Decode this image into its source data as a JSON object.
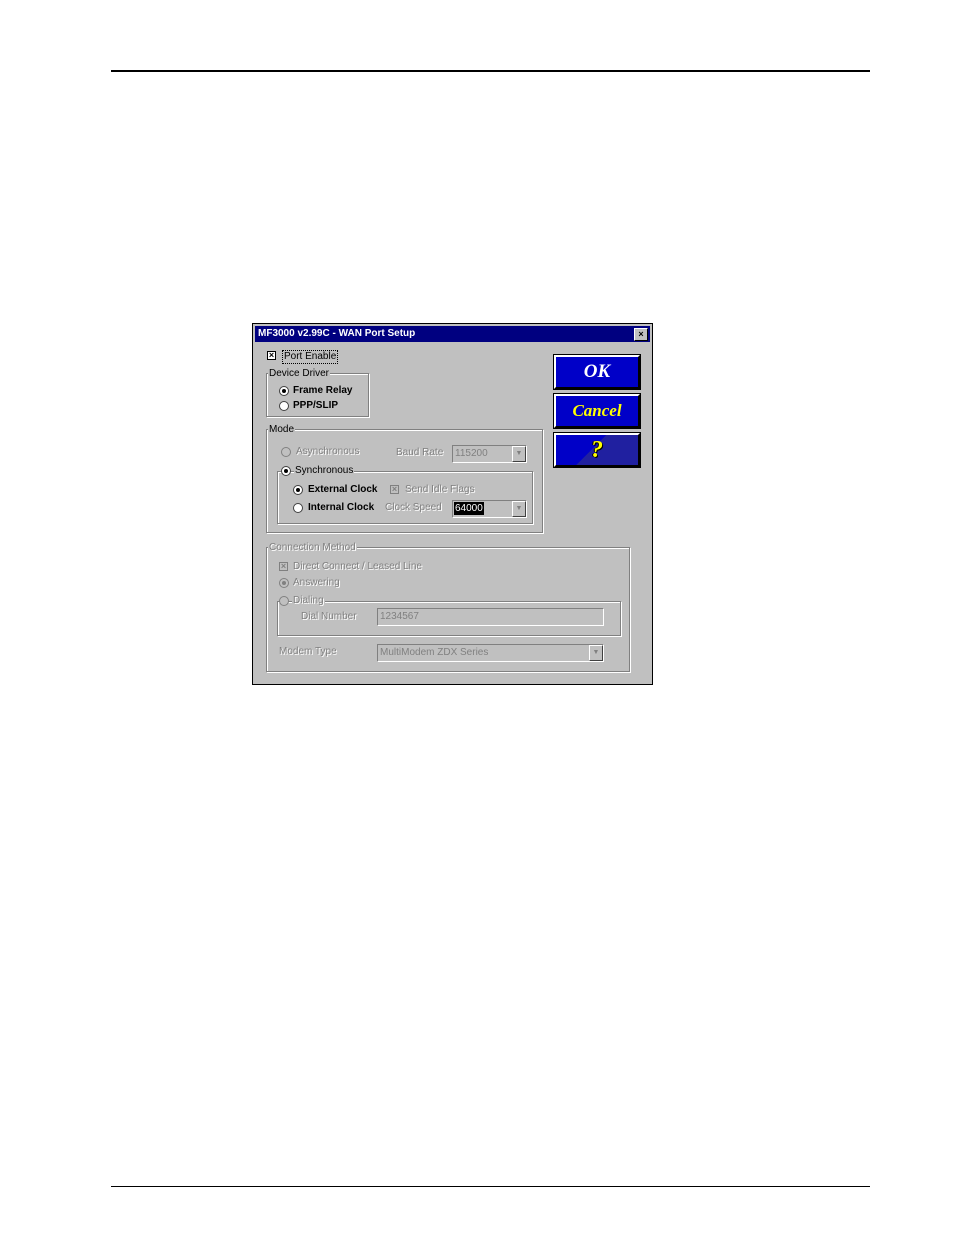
{
  "dialog": {
    "title": "MF3000 v2.99C - WAN Port Setup",
    "close_glyph": "×"
  },
  "port_enable": {
    "label": "Port Enable",
    "checked": true,
    "mark": "×"
  },
  "device_driver": {
    "title": "Device Driver",
    "options": [
      {
        "label": "Frame Relay",
        "selected": true
      },
      {
        "label": "PPP/SLIP",
        "selected": false
      }
    ]
  },
  "mode": {
    "title": "Mode",
    "asynchronous_label": "Asynchronous",
    "baud_rate_label": "Baud Rate",
    "baud_rate_value": "115200",
    "synchronous_label": "Synchronous",
    "external_clock_label": "External Clock",
    "send_idle_flags_label": "Send Idle Flags",
    "send_idle_flags_mark": "×",
    "internal_clock_label": "Internal Clock",
    "clock_speed_label": "Clock Speed",
    "clock_speed_value": "64000"
  },
  "connection": {
    "title": "Connection Method",
    "direct_connect_label": "Direct Connect / Leased Line",
    "direct_connect_mark": "×",
    "answering_label": "Answering",
    "dialing_label": "Dialing",
    "dial_number_label": "Dial Number",
    "dial_number_value": "1234567",
    "modem_type_label": "Modem Type",
    "modem_type_value": "MultiModem ZDX Series"
  },
  "buttons": {
    "ok": "OK",
    "cancel": "Cancel",
    "help": "?"
  },
  "icons": {
    "dropdown_arrow": "▼"
  }
}
